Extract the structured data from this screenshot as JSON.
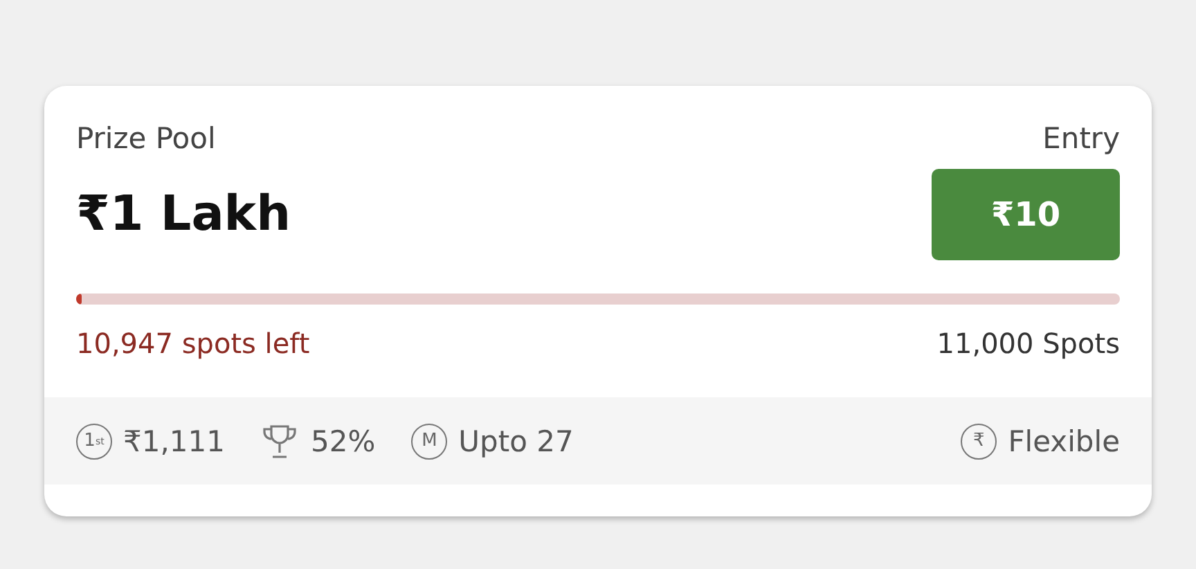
{
  "header": {
    "prize_label": "Prize Pool",
    "entry_label": "Entry"
  },
  "prize": "₹1 Lakh",
  "entry_button": "₹10",
  "progress": {
    "level": 0.005
  },
  "spots_left": "10,947 spots left",
  "total_spots": "11,000 Spots",
  "footer": [
    {
      "kind": "rank",
      "icon_label": "1$^{st}$",
      "text": "₹1,111"
    },
    {
      "kind": "trophy",
      "text": "52%"
    },
    {
      "kind": "max",
      "icon_label": "M",
      "text": "Upto 27"
    },
    {
      "kind": "flexible",
      "icon_label": "₹",
      "text": "Flexible"
    }
  ]
}
